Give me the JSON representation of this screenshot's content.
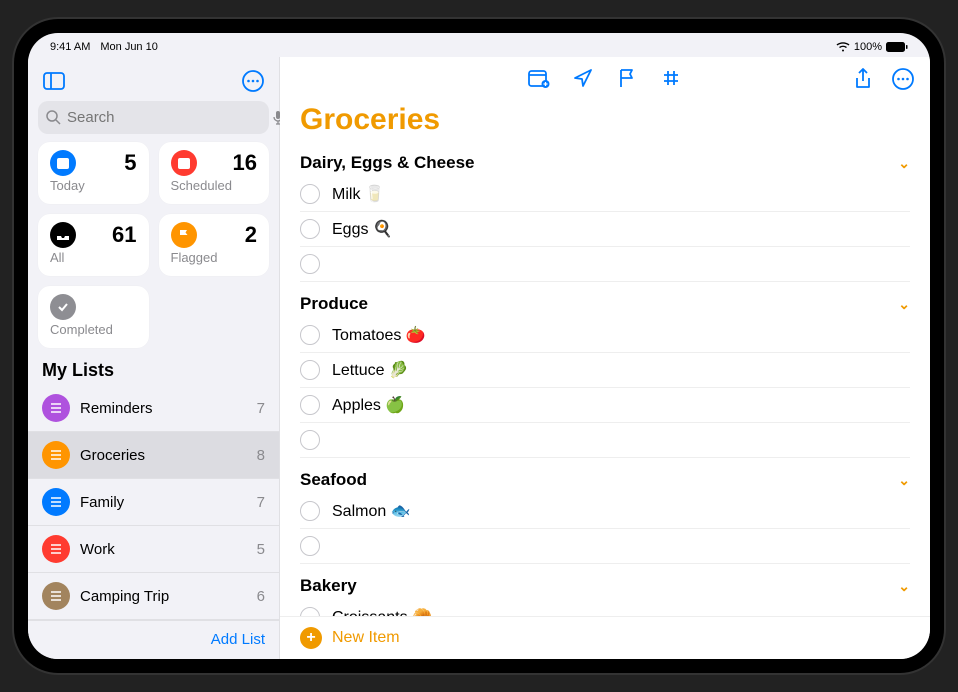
{
  "status": {
    "time": "9:41 AM",
    "date": "Mon Jun 10",
    "battery": "100%"
  },
  "sidebar": {
    "search_placeholder": "Search",
    "smart": [
      {
        "label": "Today",
        "count": "5",
        "color": "#007aff",
        "glyph": "calendar"
      },
      {
        "label": "Scheduled",
        "count": "16",
        "color": "#ff3b30",
        "glyph": "calendar"
      },
      {
        "label": "All",
        "count": "61",
        "color": "#000000",
        "glyph": "tray"
      },
      {
        "label": "Flagged",
        "count": "2",
        "color": "#ff9500",
        "glyph": "flag"
      },
      {
        "label": "Completed",
        "count": "",
        "color": "#8e8e93",
        "glyph": "check"
      }
    ],
    "lists_header": "My Lists",
    "lists": [
      {
        "name": "Reminders",
        "count": "7",
        "color": "#af52de"
      },
      {
        "name": "Groceries",
        "count": "8",
        "color": "#ff9500",
        "selected": true
      },
      {
        "name": "Family",
        "count": "7",
        "color": "#007aff"
      },
      {
        "name": "Work",
        "count": "5",
        "color": "#ff3b30"
      },
      {
        "name": "Camping Trip",
        "count": "6",
        "color": "#a2845e"
      }
    ],
    "add_list": "Add List"
  },
  "main": {
    "title": "Groceries",
    "title_color": "#f09a00",
    "new_item": "New Item",
    "groups": [
      {
        "name": "Dairy, Eggs & Cheese",
        "items": [
          {
            "text": "Milk 🥛"
          },
          {
            "text": "Eggs 🍳"
          },
          {
            "text": ""
          }
        ]
      },
      {
        "name": "Produce",
        "items": [
          {
            "text": "Tomatoes 🍅"
          },
          {
            "text": "Lettuce 🥬"
          },
          {
            "text": "Apples 🍏"
          },
          {
            "text": ""
          }
        ]
      },
      {
        "name": "Seafood",
        "items": [
          {
            "text": "Salmon 🐟"
          },
          {
            "text": ""
          }
        ]
      },
      {
        "name": "Bakery",
        "items": [
          {
            "text": "Croissants 🥐"
          }
        ]
      }
    ]
  }
}
